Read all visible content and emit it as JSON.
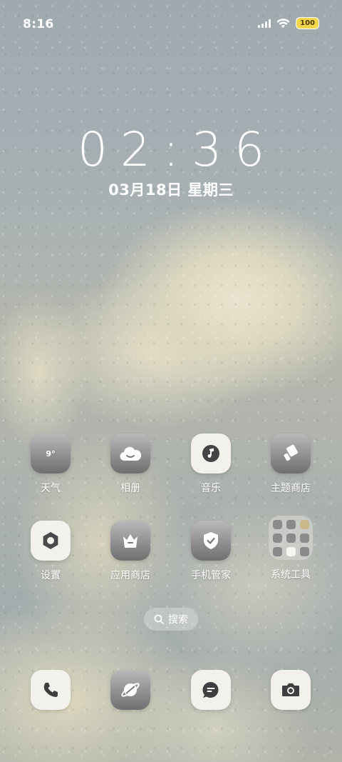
{
  "status_bar": {
    "time": "8:16",
    "battery": "100"
  },
  "lockscreen": {
    "clock": "02:36",
    "date": "03月18日 星期三"
  },
  "apps": [
    {
      "label": "天气",
      "icon": "weather-icon",
      "temp": "9°"
    },
    {
      "label": "相册",
      "icon": "cloud-gallery-icon"
    },
    {
      "label": "音乐",
      "icon": "music-icon"
    },
    {
      "label": "主题商店",
      "icon": "brush-icon"
    },
    {
      "label": "设置",
      "icon": "gear-icon"
    },
    {
      "label": "应用商店",
      "icon": "crown-bag-icon"
    },
    {
      "label": "手机管家",
      "icon": "shield-icon"
    },
    {
      "label": "系统工具",
      "icon": "folder-icon"
    }
  ],
  "search": {
    "label": "搜索"
  },
  "dock": [
    {
      "icon": "phone-icon"
    },
    {
      "icon": "browser-icon"
    },
    {
      "icon": "messages-icon"
    },
    {
      "icon": "camera-icon"
    }
  ],
  "colors": {
    "battery_fill": "#f3d64b",
    "tile_dark": "#6f6f6f",
    "tile_light": "#f2f1ec"
  }
}
